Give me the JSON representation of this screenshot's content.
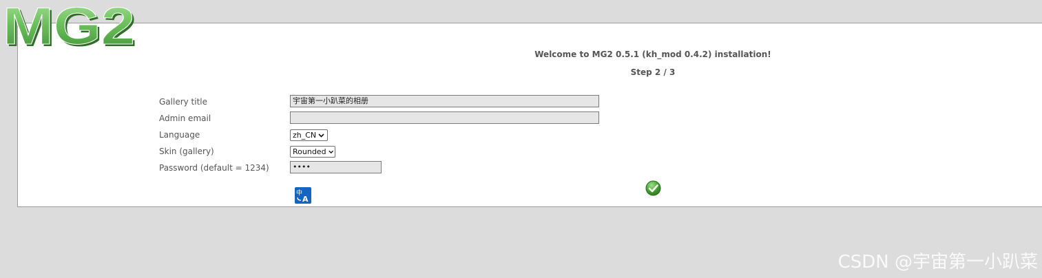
{
  "logo": {
    "text": "MG2"
  },
  "header": {
    "welcome": "Welcome to MG2 0.5.1 (kh_mod 0.4.2) installation!",
    "step": "Step 2 / 3"
  },
  "form": {
    "gallery_title": {
      "label": "Gallery title",
      "value": "宇宙第一小趴菜的相册"
    },
    "admin_email": {
      "label": "Admin email",
      "value": ""
    },
    "language": {
      "label": "Language",
      "value": "zh_CN"
    },
    "skin": {
      "label": "Skin (gallery)",
      "value": "Rounded"
    },
    "password": {
      "label": "Password (default = 1234)",
      "value": "••••"
    }
  },
  "icons": {
    "translate": "translate-icon",
    "submit": "check-icon"
  },
  "colors": {
    "background": "#dcdcdc",
    "panel": "#ffffff",
    "logo_green": "#5cb85c",
    "submit_green": "#3e9a2c",
    "translate_blue": "#1565c0"
  },
  "watermark": "CSDN @宇宙第一小趴菜"
}
